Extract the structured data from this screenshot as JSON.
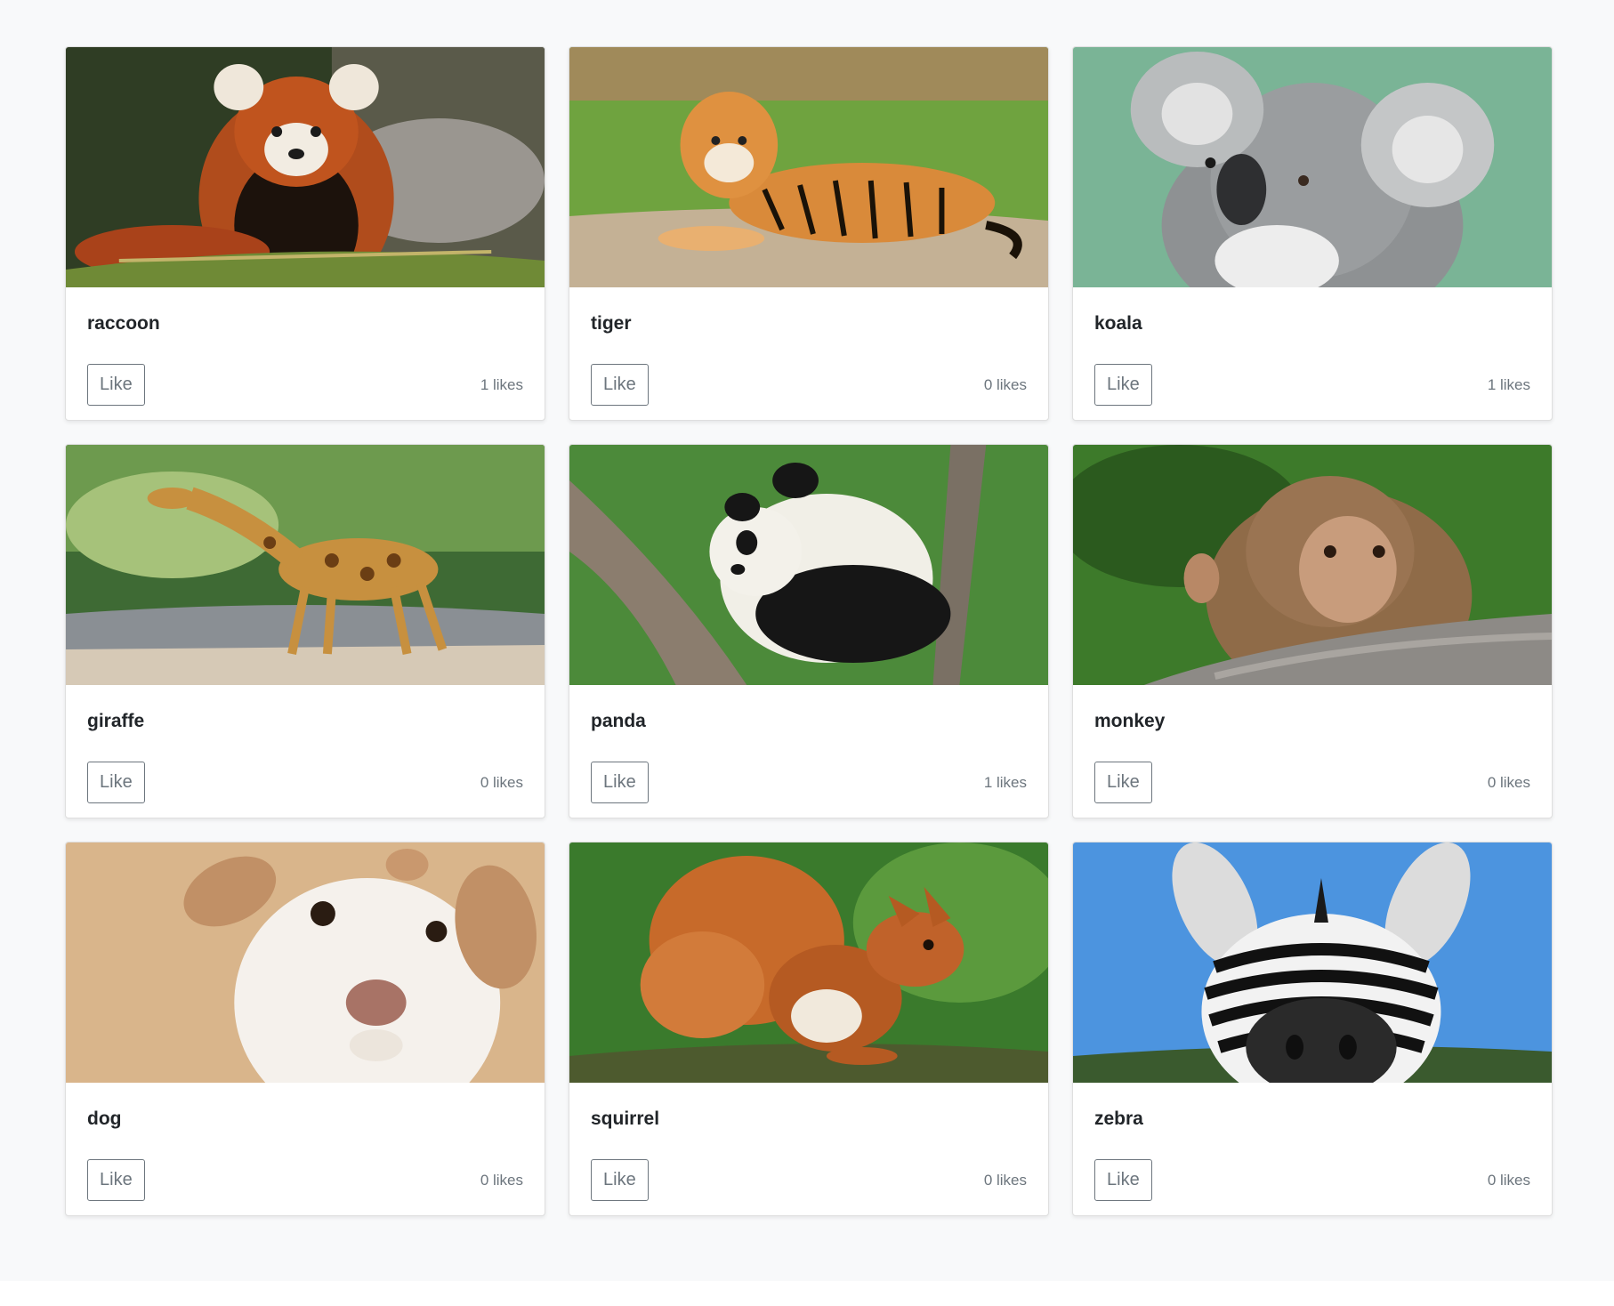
{
  "cards": [
    {
      "title": "raccoon",
      "button_label": "Like",
      "likes_text": "1 likes",
      "likes": 1,
      "image_icon": "red-panda-photo",
      "colors": {
        "bg": "#3a4a2a",
        "fg": "#b4521f",
        "accent": "#f2ece2"
      }
    },
    {
      "title": "tiger",
      "button_label": "Like",
      "likes_text": "0 likes",
      "likes": 0,
      "image_icon": "tiger-photo",
      "colors": {
        "bg": "#5f9a3a",
        "fg": "#d98a3a",
        "accent": "#c9b79c"
      }
    },
    {
      "title": "koala",
      "button_label": "Like",
      "likes_text": "1 likes",
      "likes": 1,
      "image_icon": "koala-photo",
      "colors": {
        "bg": "#78b497",
        "fg": "#8a8d90",
        "accent": "#e6e6e6"
      }
    },
    {
      "title": "giraffe",
      "button_label": "Like",
      "likes_text": "0 likes",
      "likes": 0,
      "image_icon": "giraffe-photo",
      "colors": {
        "bg": "#4f7a3e",
        "fg": "#c7903f",
        "accent": "#cfc4b5"
      }
    },
    {
      "title": "panda",
      "button_label": "Like",
      "likes_text": "1 likes",
      "likes": 1,
      "image_icon": "panda-photo",
      "colors": {
        "bg": "#4f8d3c",
        "fg": "#f1efe7",
        "accent": "#1b1b1b"
      }
    },
    {
      "title": "monkey",
      "button_label": "Like",
      "likes_text": "0 likes",
      "likes": 0,
      "image_icon": "monkey-photo",
      "colors": {
        "bg": "#3f7a2a",
        "fg": "#9a6e47",
        "accent": "#8d8a86"
      }
    },
    {
      "title": "dog",
      "button_label": "Like",
      "likes_text": "0 likes",
      "likes": 0,
      "image_icon": "dog-photo",
      "colors": {
        "bg": "#d8b48a",
        "fg": "#f5f1ec",
        "accent": "#b08257"
      }
    },
    {
      "title": "squirrel",
      "button_label": "Like",
      "likes_text": "0 likes",
      "likes": 0,
      "image_icon": "squirrel-photo",
      "colors": {
        "bg": "#3a7a2c",
        "fg": "#c76a2a",
        "accent": "#f1e9dc"
      }
    },
    {
      "title": "zebra",
      "button_label": "Like",
      "likes_text": "0 likes",
      "likes": 0,
      "image_icon": "zebra-photo",
      "colors": {
        "bg": "#4b94df",
        "fg": "#f2f2f2",
        "accent": "#1a1a1a"
      }
    }
  ]
}
